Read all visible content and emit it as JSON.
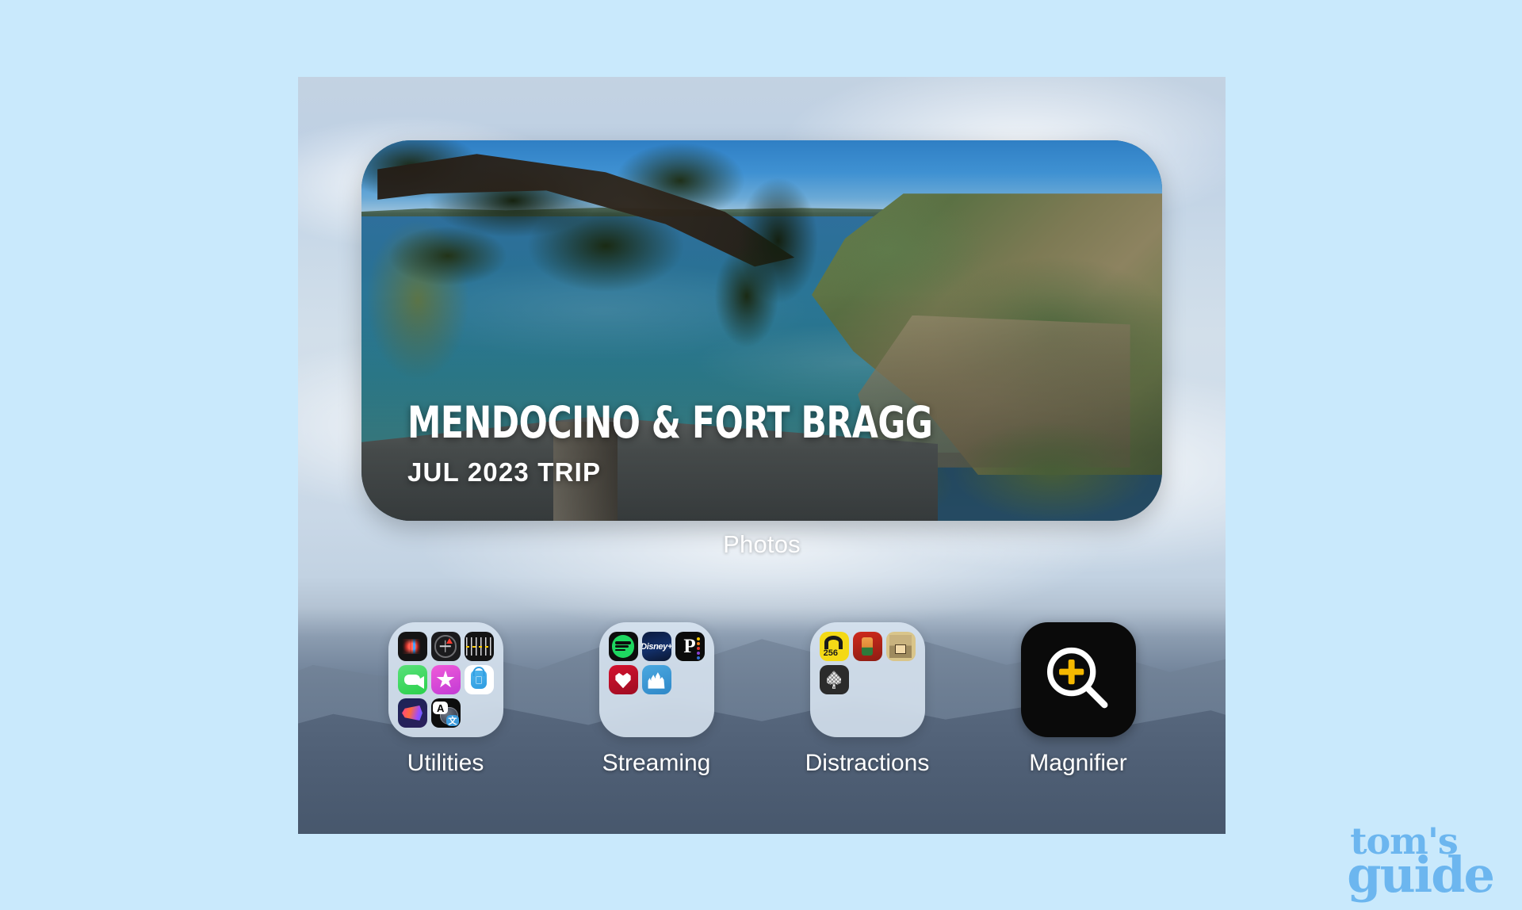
{
  "page": {
    "background_color": "#c9e9fc"
  },
  "watermark": {
    "line1": "tom's",
    "line2": "guide",
    "color": "#6cb6ef"
  },
  "home_screen": {
    "photos_widget": {
      "label": "Photos",
      "title": "MENDOCINO & FORT BRAGG",
      "subtitle": "JUL 2023 TRIP",
      "memory_scene": "coastal headland with ocean, pine tree and wooden deck"
    },
    "dock": [
      {
        "name": "Utilities",
        "type": "folder",
        "apps": [
          {
            "label": "Voice Memos",
            "icon": "voice-memos-icon"
          },
          {
            "label": "Compass",
            "icon": "compass-icon"
          },
          {
            "label": "Measure",
            "icon": "measure-icon"
          },
          {
            "label": "FaceTime",
            "icon": "facetime-icon"
          },
          {
            "label": "iTunes Store",
            "icon": "itunes-store-icon"
          },
          {
            "label": "Apple Store",
            "icon": "apple-store-icon"
          },
          {
            "label": "Shortcuts",
            "icon": "shortcuts-icon"
          },
          {
            "label": "Translate",
            "icon": "translate-icon"
          }
        ]
      },
      {
        "name": "Streaming",
        "type": "folder",
        "apps": [
          {
            "label": "Spotify",
            "icon": "spotify-icon"
          },
          {
            "label": "Disney+",
            "icon": "disney-plus-icon"
          },
          {
            "label": "Peacock",
            "icon": "peacock-icon"
          },
          {
            "label": "iHeartRadio",
            "icon": "iheartradio-icon"
          },
          {
            "label": "Disneyland",
            "icon": "disneyland-icon"
          }
        ]
      },
      {
        "name": "Distractions",
        "type": "folder",
        "apps": [
          {
            "label": "256",
            "icon": "game-256-icon"
          },
          {
            "label": "Pixel Adventure",
            "icon": "pixel-adventure-icon"
          },
          {
            "label": "Pixel Dungeon",
            "icon": "pixel-dungeon-icon"
          },
          {
            "label": "Solitaire",
            "icon": "solitaire-icon"
          }
        ]
      },
      {
        "name": "Magnifier",
        "type": "app",
        "icon": "magnifier-icon",
        "icon_colors": {
          "background": "#0a0a0a",
          "glass": "#ffffff",
          "plus": "#f5b800"
        }
      }
    ]
  }
}
